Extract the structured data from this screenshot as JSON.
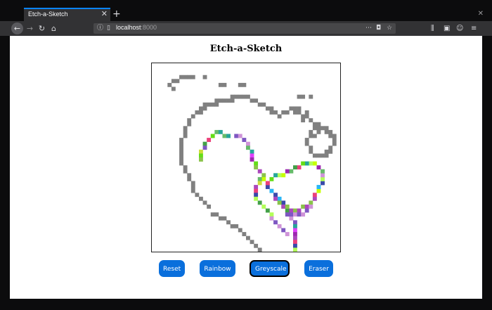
{
  "browser": {
    "tab_title": "Etch-a-Sketch",
    "tab_close": "✕",
    "new_tab": "+",
    "window_close": "✕",
    "url_host": "localhost",
    "url_port": ":8000"
  },
  "page": {
    "title": "Etch-a-Sketch"
  },
  "buttons": {
    "reset": "Reset",
    "rainbow": "Rainbow",
    "greyscale": "Greyscale",
    "eraser": "Eraser",
    "active_mode": "greyscale"
  },
  "sketch": {
    "grid_size": 48,
    "grey": "#808080",
    "rainbow_palette": [
      "#e040fb",
      "#66bb6a",
      "#7e57c2",
      "#b2ff59",
      "#29b6f6",
      "#ec407a",
      "#8bc34a",
      "#9c27b0",
      "#cddc39",
      "#26a69a",
      "#ce93d8",
      "#43a047",
      "#3949ab",
      "#c6ff00",
      "#ab47bc",
      "#64dd17"
    ],
    "grey_cells": [
      [
        4,
        5
      ],
      [
        5,
        4
      ],
      [
        5,
        6
      ],
      [
        6,
        4
      ],
      [
        7,
        3
      ],
      [
        8,
        3
      ],
      [
        9,
        3
      ],
      [
        10,
        3
      ],
      [
        13,
        3
      ],
      [
        17,
        5
      ],
      [
        18,
        5
      ],
      [
        22,
        5
      ],
      [
        23,
        5
      ],
      [
        20,
        8
      ],
      [
        21,
        8
      ],
      [
        22,
        8
      ],
      [
        23,
        8
      ],
      [
        18,
        9
      ],
      [
        19,
        9
      ],
      [
        20,
        9
      ],
      [
        16,
        9
      ],
      [
        17,
        9
      ],
      [
        13,
        10
      ],
      [
        14,
        10
      ],
      [
        15,
        10
      ],
      [
        16,
        10
      ],
      [
        12,
        11
      ],
      [
        13,
        11
      ],
      [
        12,
        12
      ],
      [
        11,
        12
      ],
      [
        10,
        13
      ],
      [
        9,
        14
      ],
      [
        9,
        15
      ],
      [
        8,
        16
      ],
      [
        8,
        17
      ],
      [
        8,
        18
      ],
      [
        7,
        19
      ],
      [
        7,
        20
      ],
      [
        7,
        21
      ],
      [
        7,
        22
      ],
      [
        7,
        23
      ],
      [
        7,
        24
      ],
      [
        7,
        25
      ],
      [
        8,
        26
      ],
      [
        8,
        27
      ],
      [
        9,
        28
      ],
      [
        9,
        29
      ],
      [
        10,
        30
      ],
      [
        10,
        31
      ],
      [
        10,
        32
      ],
      [
        11,
        33
      ],
      [
        12,
        34
      ],
      [
        13,
        35
      ],
      [
        14,
        36
      ],
      [
        15,
        38
      ],
      [
        16,
        38
      ],
      [
        17,
        39
      ],
      [
        18,
        39
      ],
      [
        19,
        40
      ],
      [
        20,
        41
      ],
      [
        21,
        41
      ],
      [
        22,
        42
      ],
      [
        23,
        43
      ],
      [
        24,
        44
      ],
      [
        25,
        45
      ],
      [
        26,
        46
      ],
      [
        27,
        47
      ],
      [
        24,
        8
      ],
      [
        25,
        9
      ],
      [
        26,
        9
      ],
      [
        27,
        10
      ],
      [
        28,
        10
      ],
      [
        29,
        11
      ],
      [
        30,
        11
      ],
      [
        30,
        12
      ],
      [
        31,
        12
      ],
      [
        32,
        13
      ],
      [
        33,
        12
      ],
      [
        34,
        12
      ],
      [
        35,
        11
      ],
      [
        36,
        11
      ],
      [
        37,
        11
      ],
      [
        37,
        12
      ],
      [
        38,
        13
      ],
      [
        39,
        12
      ],
      [
        39,
        13
      ],
      [
        40,
        14
      ],
      [
        41,
        15
      ],
      [
        42,
        15
      ],
      [
        43,
        16
      ],
      [
        44,
        16
      ],
      [
        44,
        17
      ],
      [
        45,
        17
      ],
      [
        45,
        18
      ],
      [
        46,
        18
      ],
      [
        46,
        19
      ],
      [
        46,
        20
      ],
      [
        45,
        21
      ],
      [
        45,
        22
      ],
      [
        44,
        22
      ],
      [
        44,
        23
      ],
      [
        43,
        23
      ],
      [
        42,
        23
      ],
      [
        41,
        23
      ],
      [
        40,
        22
      ],
      [
        40,
        21
      ],
      [
        39,
        20
      ],
      [
        39,
        19
      ],
      [
        40,
        18
      ],
      [
        41,
        18
      ],
      [
        42,
        17
      ],
      [
        42,
        16
      ],
      [
        40,
        17
      ],
      [
        41,
        16
      ],
      [
        38,
        14
      ],
      [
        36,
        12
      ],
      [
        37,
        8
      ],
      [
        38,
        8
      ],
      [
        40,
        8
      ]
    ],
    "rainbow_cells": [
      [
        15,
        18
      ],
      [
        14,
        19
      ],
      [
        13,
        20
      ],
      [
        13,
        21
      ],
      [
        12,
        22
      ],
      [
        12,
        23
      ],
      [
        12,
        24
      ],
      [
        16,
        17
      ],
      [
        17,
        17
      ],
      [
        18,
        18
      ],
      [
        19,
        18
      ],
      [
        21,
        18
      ],
      [
        22,
        18
      ],
      [
        23,
        19
      ],
      [
        24,
        20
      ],
      [
        24,
        21
      ],
      [
        25,
        22
      ],
      [
        25,
        23
      ],
      [
        25,
        24
      ],
      [
        26,
        25
      ],
      [
        26,
        26
      ],
      [
        27,
        27
      ],
      [
        28,
        28
      ],
      [
        28,
        29
      ],
      [
        29,
        30
      ],
      [
        29,
        31
      ],
      [
        30,
        32
      ],
      [
        31,
        33
      ],
      [
        32,
        34
      ],
      [
        33,
        35
      ],
      [
        33,
        36
      ],
      [
        34,
        37
      ],
      [
        34,
        38
      ],
      [
        35,
        39
      ],
      [
        36,
        40
      ],
      [
        36,
        41
      ],
      [
        36,
        42
      ],
      [
        36,
        43
      ],
      [
        36,
        44
      ],
      [
        36,
        45
      ],
      [
        36,
        46
      ],
      [
        36,
        47
      ],
      [
        27,
        29
      ],
      [
        27,
        30
      ],
      [
        26,
        31
      ],
      [
        26,
        32
      ],
      [
        26,
        33
      ],
      [
        26,
        34
      ],
      [
        27,
        35
      ],
      [
        28,
        36
      ],
      [
        29,
        37
      ],
      [
        30,
        38
      ],
      [
        30,
        39
      ],
      [
        31,
        40
      ],
      [
        32,
        41
      ],
      [
        33,
        42
      ],
      [
        34,
        43
      ],
      [
        31,
        34
      ],
      [
        32,
        35
      ],
      [
        33,
        36
      ],
      [
        34,
        36
      ],
      [
        35,
        37
      ],
      [
        36,
        37
      ],
      [
        37,
        37
      ],
      [
        38,
        36
      ],
      [
        39,
        36
      ],
      [
        40,
        35
      ],
      [
        41,
        34
      ],
      [
        41,
        33
      ],
      [
        42,
        32
      ],
      [
        42,
        31
      ],
      [
        43,
        30
      ],
      [
        43,
        29
      ],
      [
        43,
        28
      ],
      [
        43,
        27
      ],
      [
        42,
        26
      ],
      [
        41,
        25
      ],
      [
        40,
        25
      ],
      [
        39,
        25
      ],
      [
        38,
        25
      ],
      [
        37,
        26
      ],
      [
        36,
        26
      ],
      [
        35,
        27
      ],
      [
        34,
        27
      ],
      [
        33,
        28
      ],
      [
        32,
        28
      ],
      [
        31,
        28
      ],
      [
        30,
        29
      ],
      [
        29,
        30
      ],
      [
        35,
        38
      ],
      [
        36,
        38
      ],
      [
        37,
        38
      ],
      [
        38,
        38
      ],
      [
        39,
        37
      ],
      [
        40,
        36
      ]
    ]
  }
}
